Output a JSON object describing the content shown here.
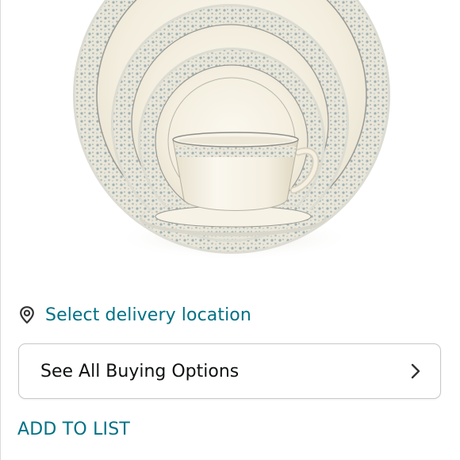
{
  "product": {
    "image_alt": "Place setting of cream dinnerware with blue-grey floral rim, teacup and saucer"
  },
  "delivery": {
    "icon": "location-pin-icon",
    "link_label": "Select delivery location"
  },
  "buying_options": {
    "label": "See All Buying Options",
    "icon": "chevron-right-icon"
  },
  "actions": {
    "add_to_list_label": "ADD TO LIST"
  },
  "colors": {
    "link": "#007185",
    "text": "#0f1111",
    "border": "#c8c8c8"
  }
}
